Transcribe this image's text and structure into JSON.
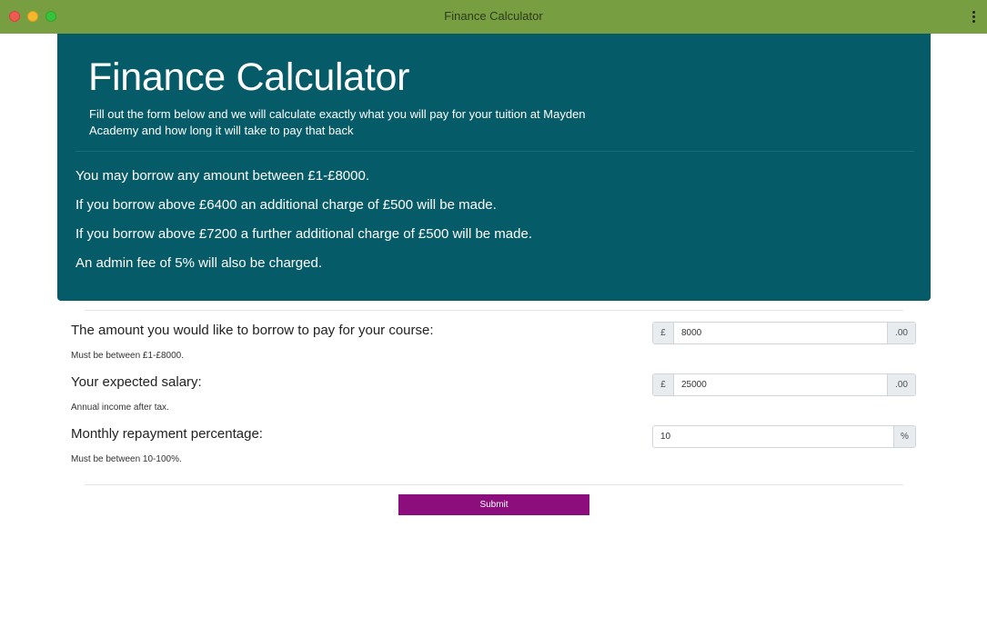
{
  "window": {
    "title": "Finance Calculator"
  },
  "header": {
    "title": "Finance Calculator",
    "lead": "Fill out the form below and we will calculate exactly what you will pay for your tuition at Mayden Academy and how long it will take to pay that back"
  },
  "rules": [
    "You may borrow any amount between £1-£8000.",
    "If you borrow above £6400 an additional charge of £500 will be made.",
    "If you borrow above £7200 a further additional charge of £500 will be made.",
    "An admin fee of 5% will also be charged."
  ],
  "form": {
    "loan": {
      "label": "The amount you would like to borrow to pay for your course:",
      "help": "Must be between £1-£8000.",
      "prefix": "£",
      "value": "8000",
      "suffix": ".00"
    },
    "salary": {
      "label": "Your expected salary:",
      "help": "Annual income after tax.",
      "prefix": "£",
      "value": "25000",
      "suffix": ".00"
    },
    "repayment": {
      "label": "Monthly repayment percentage:",
      "help": "Must be between 10-100%.",
      "value": "10",
      "suffix": "%"
    },
    "submit_label": "Submit"
  },
  "colors": {
    "titlebar": "#779e41",
    "jumbotron": "#065b69",
    "submit": "#8c0d7c"
  }
}
